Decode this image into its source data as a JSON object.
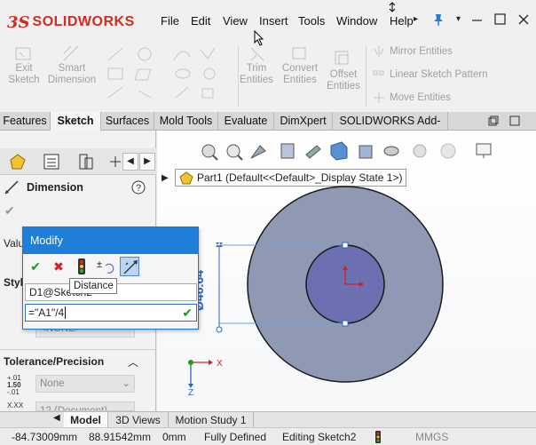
{
  "app": {
    "logo_prefix": "3S",
    "logo_text": "SOLIDWORKS"
  },
  "menu": [
    "File",
    "Edit",
    "View",
    "Insert",
    "Tools",
    "Window",
    "Help"
  ],
  "commands": {
    "exit_sketch": [
      "Exit",
      "Sketch"
    ],
    "smart_dimension": [
      "Smart",
      "Dimension"
    ],
    "trim_entities": [
      "Trim",
      "Entities"
    ],
    "convert_entities": [
      "Convert",
      "Entities"
    ],
    "offset_entities": [
      "Offset",
      "Entities"
    ],
    "mirror_entities": "Mirror Entities",
    "linear_pattern": "Linear Sketch Pattern",
    "move_entities": "Move Entities"
  },
  "tabs": [
    "Features",
    "Sketch",
    "Surfaces",
    "Mold Tools",
    "Evaluate",
    "DimXpert",
    "SOLIDWORKS Add-Ins"
  ],
  "panel": {
    "title": "Dimension",
    "value_label": "Valu",
    "style_label": "Styl",
    "style_combo": "<NONE>",
    "tolerance_header": "Tolerance/Precision",
    "tol_values": [
      "+.01",
      "1.50",
      "-.01"
    ],
    "tolerance_combo": "None",
    "precision_code": "X.XX",
    "precision_combo": "12 (Document)"
  },
  "modify": {
    "title": "Modify",
    "tooltip": "Distance",
    "dimension_name": "D1@Sketch2",
    "equation": "=\"A1\"/4"
  },
  "viewport": {
    "breadcrumb": "Part1  (Default<<Default>_Display State 1>)",
    "dimension_label": "Ø46.64"
  },
  "bottom_tabs": [
    "Model",
    "3D Views",
    "Motion Study 1"
  ],
  "status": {
    "x": "-84.73009mm",
    "y": "88.91542mm",
    "z": "0mm",
    "state": "Fully Defined",
    "editing": "Editing Sketch2",
    "units": "MMGS"
  },
  "colors": {
    "accent": "#1f7fd8",
    "brand": "#d52b1e",
    "part": "#8f99b3"
  }
}
